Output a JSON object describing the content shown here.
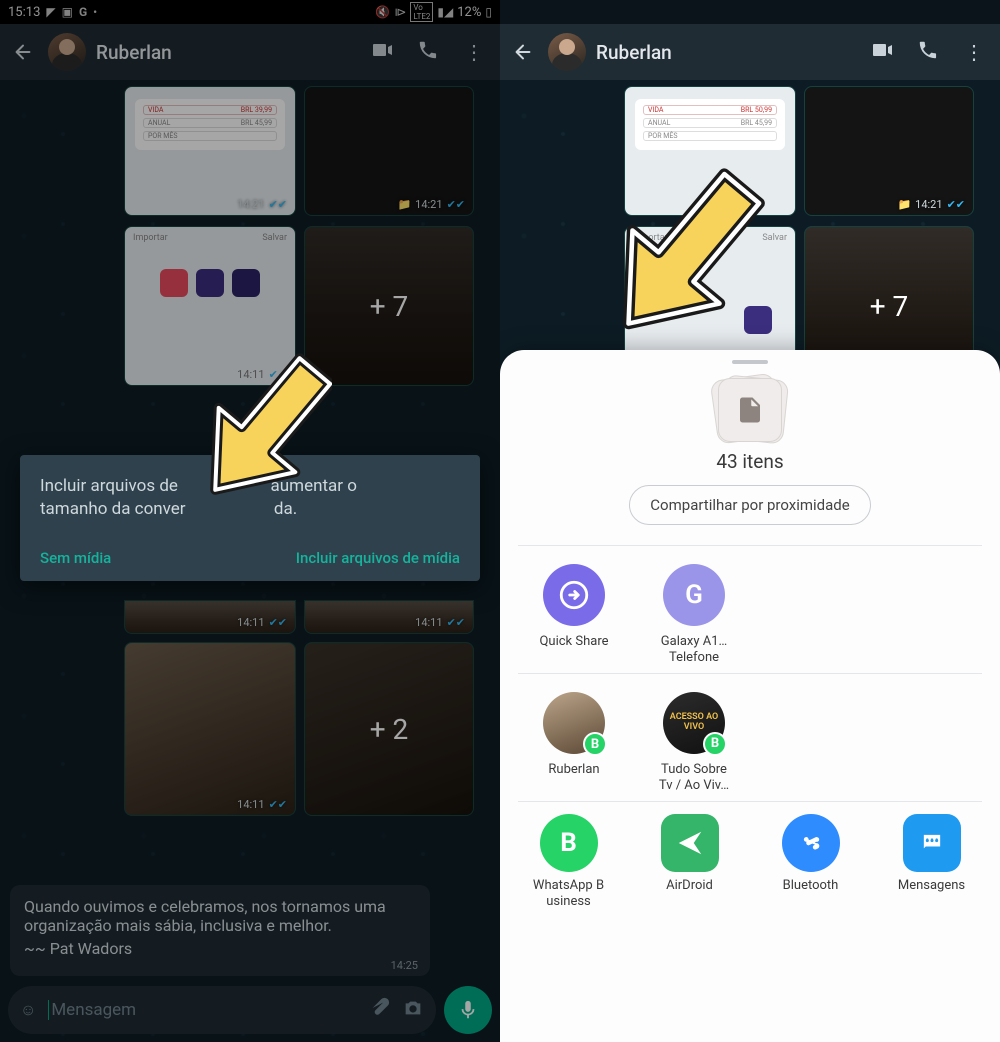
{
  "statusbar": {
    "time": "15:13",
    "battery": "12%"
  },
  "left": {
    "contact": "Ruberlan",
    "times": {
      "a": "14:21",
      "b": "14:21",
      "c": "14:11",
      "d": "14:11",
      "e": "14:11",
      "f": "14:11"
    },
    "plus7": "+ 7",
    "plus2": "+ 2",
    "dialog": {
      "text_a": "Incluir arquivos de",
      "text_b": "aumentar o",
      "text_c": "tamanho da conver",
      "text_d": "da.",
      "btn_no_media": "Sem mídia",
      "btn_include": "Incluir arquivos de mídia"
    },
    "quote": {
      "body": "Quando ouvimos e celebramos, nos tornamos uma organização mais sábia, inclusiva e melhor.",
      "by": "~~ Pat Wadors",
      "time": "14:25"
    },
    "composer_placeholder": "Mensagem"
  },
  "right": {
    "contact": "Ruberlan",
    "plus7": "+ 7",
    "times": {
      "a": "14:21"
    },
    "sheet": {
      "items_label": "43 itens",
      "nearby": "Compartilhar por proximidade",
      "quick_share": "Quick Share",
      "galaxy_line1": "Galaxy A1…",
      "galaxy_line2": "Telefone",
      "contact1": "Ruberlan",
      "contact2_line1": "Tudo Sobre",
      "contact2_line2": "Tv / Ao Viv…",
      "app1_line1": "WhatsApp B",
      "app1_line2": "usiness",
      "app2": "AirDroid",
      "app3": "Bluetooth",
      "app4": "Mensagens"
    }
  }
}
